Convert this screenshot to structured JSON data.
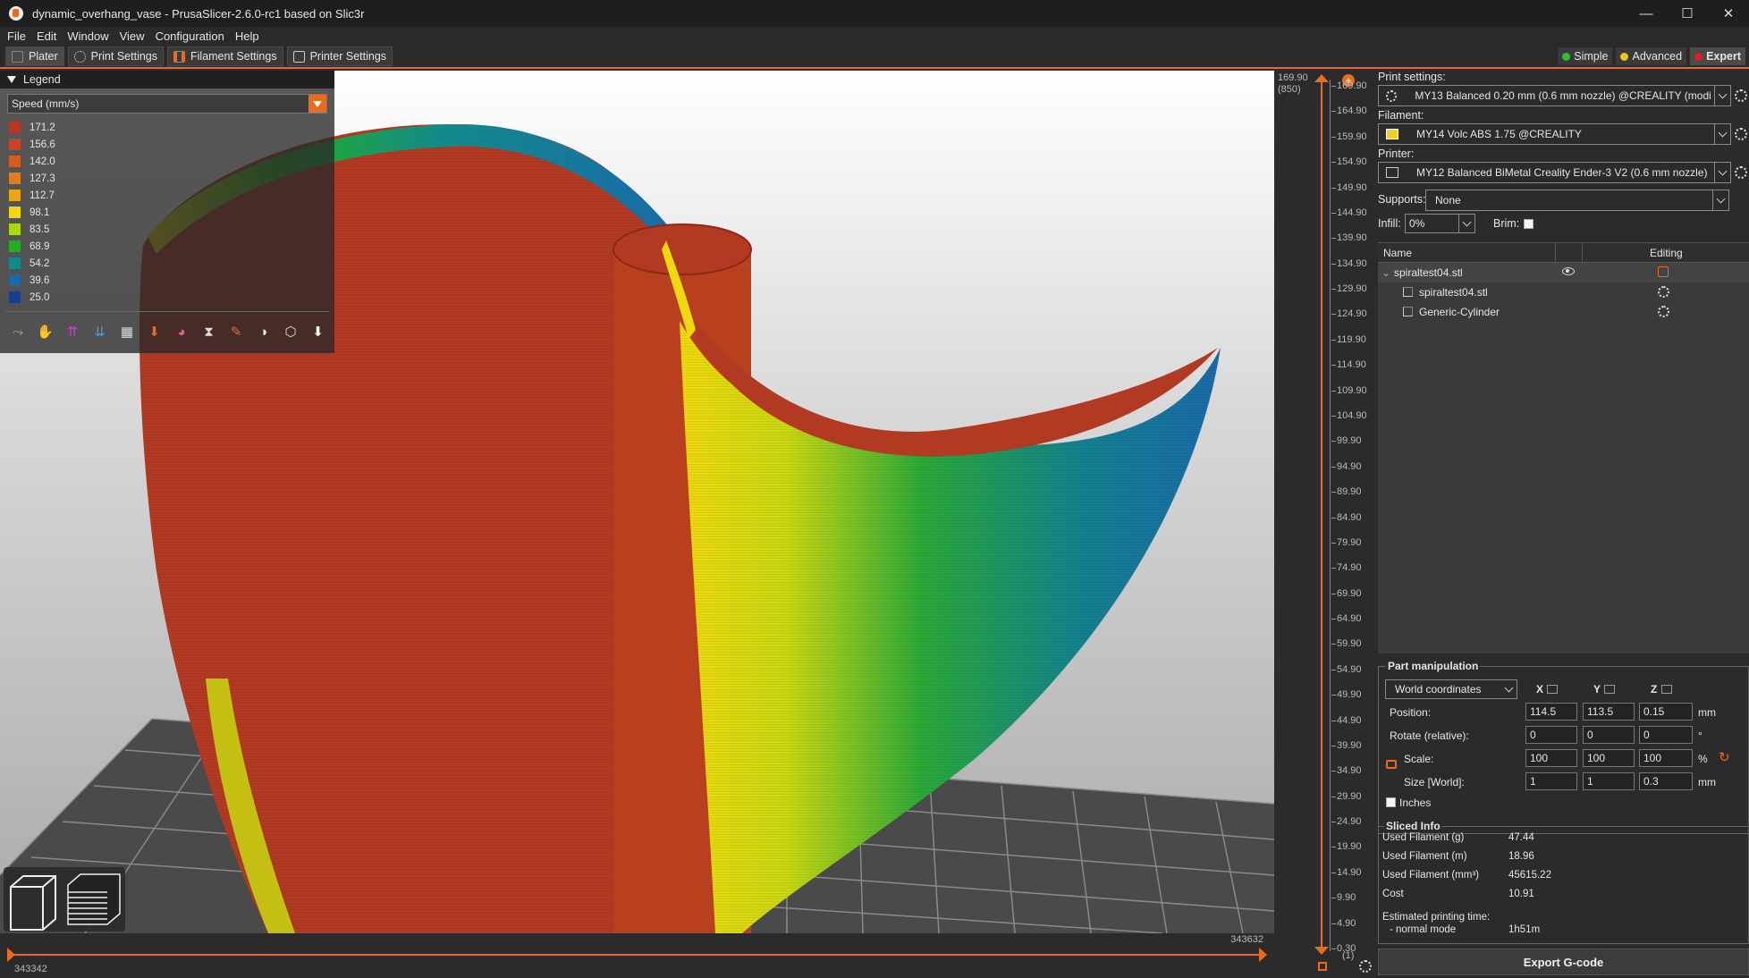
{
  "window": {
    "title": "dynamic_overhang_vase - PrusaSlicer-2.6.0-rc1 based on Slic3r",
    "controls": [
      "—",
      "☐",
      "✕"
    ]
  },
  "menu": [
    "File",
    "Edit",
    "Window",
    "View",
    "Configuration",
    "Help"
  ],
  "tabs": [
    {
      "label": "Plater",
      "icon": "plater-icon"
    },
    {
      "label": "Print Settings",
      "icon": "gear-icon"
    },
    {
      "label": "Filament Settings",
      "icon": "spool-icon"
    },
    {
      "label": "Printer Settings",
      "icon": "printer-icon"
    }
  ],
  "modes": [
    {
      "label": "Simple",
      "color": "#2ebf2e"
    },
    {
      "label": "Advanced",
      "color": "#f0c419"
    },
    {
      "label": "Expert",
      "color": "#e02020"
    }
  ],
  "legend": {
    "title": "Legend",
    "view_type": "Speed (mm/s)",
    "entries": [
      {
        "value": "171.2",
        "color": "#b33a22"
      },
      {
        "value": "156.6",
        "color": "#c4452a"
      },
      {
        "value": "142.0",
        "color": "#d65a24"
      },
      {
        "value": "127.3",
        "color": "#e07d1c"
      },
      {
        "value": "112.7",
        "color": "#e8a815"
      },
      {
        "value": "98.1",
        "color": "#f0d80e"
      },
      {
        "value": "83.5",
        "color": "#a8d812"
      },
      {
        "value": "68.9",
        "color": "#22b022"
      },
      {
        "value": "54.2",
        "color": "#128a8a"
      },
      {
        "value": "39.6",
        "color": "#1a6aa8"
      },
      {
        "value": "25.0",
        "color": "#1a3e8c"
      }
    ],
    "options": [
      "travel-icon",
      "wipe-icon",
      "retractions-icon",
      "deretractions-icon",
      "seams-icon",
      "tool-changes-icon",
      "color-changes-icon",
      "pause-prints-icon",
      "custom-gcodes-icon",
      "center-of-gravity-icon",
      "shells-icon",
      "tool-marker-icon"
    ]
  },
  "horizontal_slider": {
    "left_value": "343342",
    "right_value": "343632"
  },
  "vertical_slider": {
    "top_value": "169.90",
    "top_layer": "(850)",
    "bottom_layer": "(1)",
    "ticks": [
      "169.90",
      "164.90",
      "159.90",
      "154.90",
      "149.90",
      "144.90",
      "139.90",
      "134.90",
      "129.90",
      "124.90",
      "119.90",
      "114.90",
      "109.90",
      "104.90",
      "99.90",
      "94.90",
      "89.90",
      "84.90",
      "79.90",
      "74.90",
      "69.90",
      "64.90",
      "59.90",
      "54.90",
      "49.90",
      "44.90",
      "39.90",
      "34.90",
      "29.90",
      "24.90",
      "19.90",
      "14.90",
      "9.90",
      "4.90",
      "0.30"
    ]
  },
  "sidebar": {
    "print_settings_label": "Print settings:",
    "print_settings_value": "MY13 Balanced 0.20 mm (0.6 mm nozzle) @CREALITY (modified)",
    "filament_label": "Filament:",
    "filament_value": "MY14 Volc ABS 1.75 @CREALITY",
    "filament_color": "#f0d020",
    "printer_label": "Printer:",
    "printer_value": "MY12 Balanced BiMetal Creality Ender-3 V2 (0.6 mm nozzle)",
    "supports_label": "Supports:",
    "supports_value": "None",
    "infill_label": "Infill:",
    "infill_value": "0%",
    "brim_label": "Brim:"
  },
  "object_list": {
    "columns": [
      "Name",
      "Editing"
    ],
    "rows": [
      {
        "name": "spiraltest04.stl"
      },
      {
        "name": "spiraltest04.stl"
      },
      {
        "name": "Generic-Cylinder"
      }
    ]
  },
  "part_manipulation": {
    "title": "Part manipulation",
    "coordinates": "World coordinates",
    "axes": [
      "X",
      "Y",
      "Z"
    ],
    "position_label": "Position:",
    "position": [
      "114.5",
      "113.5",
      "0.15"
    ],
    "position_unit": "mm",
    "rotate_label": "Rotate (relative):",
    "rotate": [
      "0",
      "0",
      "0"
    ],
    "rotate_unit": "°",
    "scale_label": "Scale:",
    "scale": [
      "100",
      "100",
      "100"
    ],
    "scale_unit": "%",
    "size_label": "Size [World]:",
    "size": [
      "1",
      "1",
      "0.3"
    ],
    "size_unit": "mm",
    "inches_label": "Inches"
  },
  "sliced_info": {
    "title": "Sliced Info",
    "rows": [
      {
        "label": "Used Filament (g)",
        "value": "47.44"
      },
      {
        "label": "Used Filament (m)",
        "value": "18.96"
      },
      {
        "label": "Used Filament (mm³)",
        "value": "45615.22"
      },
      {
        "label": "Cost",
        "value": "10.91"
      }
    ],
    "time_label": "Estimated printing time:",
    "mode_label": "- normal mode",
    "mode_value": "1h51m"
  },
  "export_button": "Export G-code"
}
